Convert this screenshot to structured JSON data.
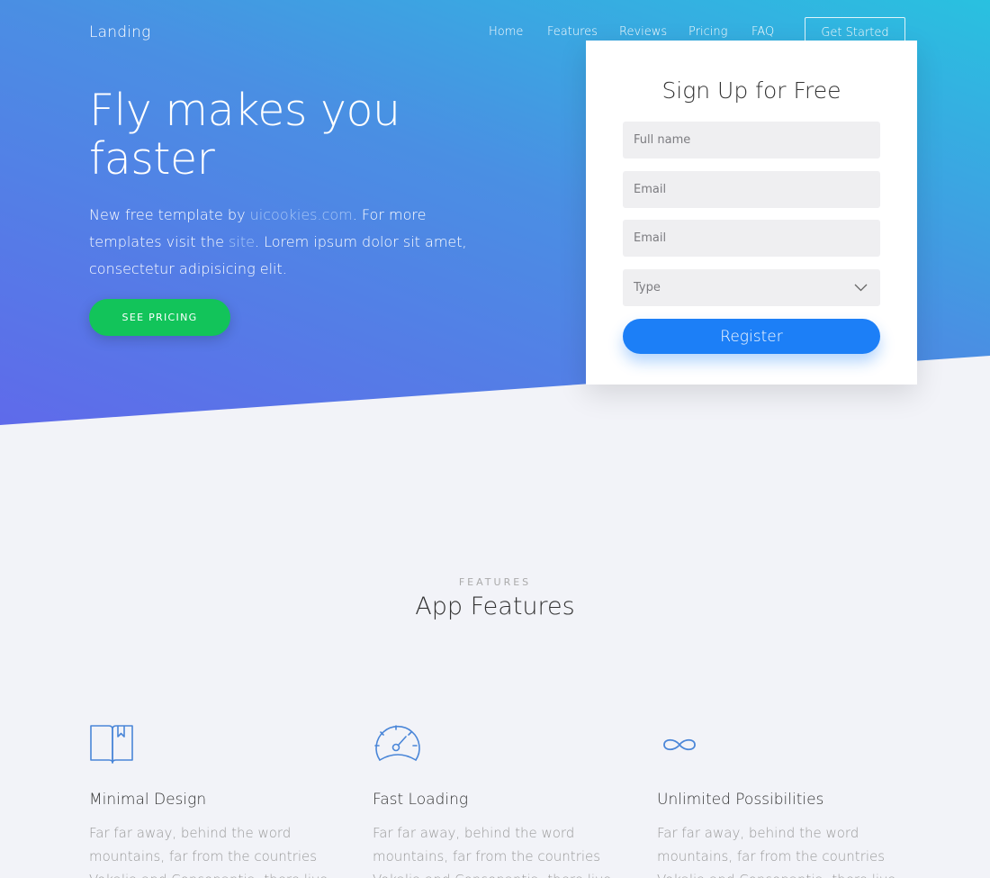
{
  "brand": "Landing",
  "nav": {
    "items": [
      "Home",
      "Features",
      "Reviews",
      "Pricing",
      "FAQ"
    ],
    "cta": "Get Started"
  },
  "hero": {
    "title_line1": "Fly makes you",
    "title_line2": "faster",
    "text_part1": "New free template by ",
    "text_link1": "uicookies.com",
    "text_part2": ". For more templates visit the ",
    "text_link2": "site",
    "text_part3": ". Lorem ipsum dolor sit amet, consectetur adipisicing elit.",
    "button": "SEE PRICING"
  },
  "signup": {
    "title": "Sign Up for Free",
    "fields": [
      {
        "placeholder": "Full name"
      },
      {
        "placeholder": "Email"
      },
      {
        "placeholder": "Email"
      }
    ],
    "select": {
      "label": "Type"
    },
    "button": "Register"
  },
  "features": {
    "eyebrow": "FEATURES",
    "title": "App Features",
    "items": [
      {
        "icon": "book-icon",
        "title": "Minimal Design",
        "text": "Far far away, behind the word mountains, far from the countries Vokalia and Consonantia, there live the"
      },
      {
        "icon": "speedometer-icon",
        "title": "Fast Loading",
        "text": "Far far away, behind the word mountains, far from the countries Vokalia and Consonantia, there live the"
      },
      {
        "icon": "infinity-icon",
        "title": "Unlimited Possibilities",
        "text": "Far far away, behind the word mountains, far from the countries Vokalia and Consonantia, there live the"
      }
    ]
  },
  "colors": {
    "hero_gradient_start": "#29c1e0",
    "hero_gradient_end": "#5f6aea",
    "pricing_button": "#12c45a",
    "register_button": "#1c7ff7",
    "icon_stroke": "#4a86d8"
  }
}
